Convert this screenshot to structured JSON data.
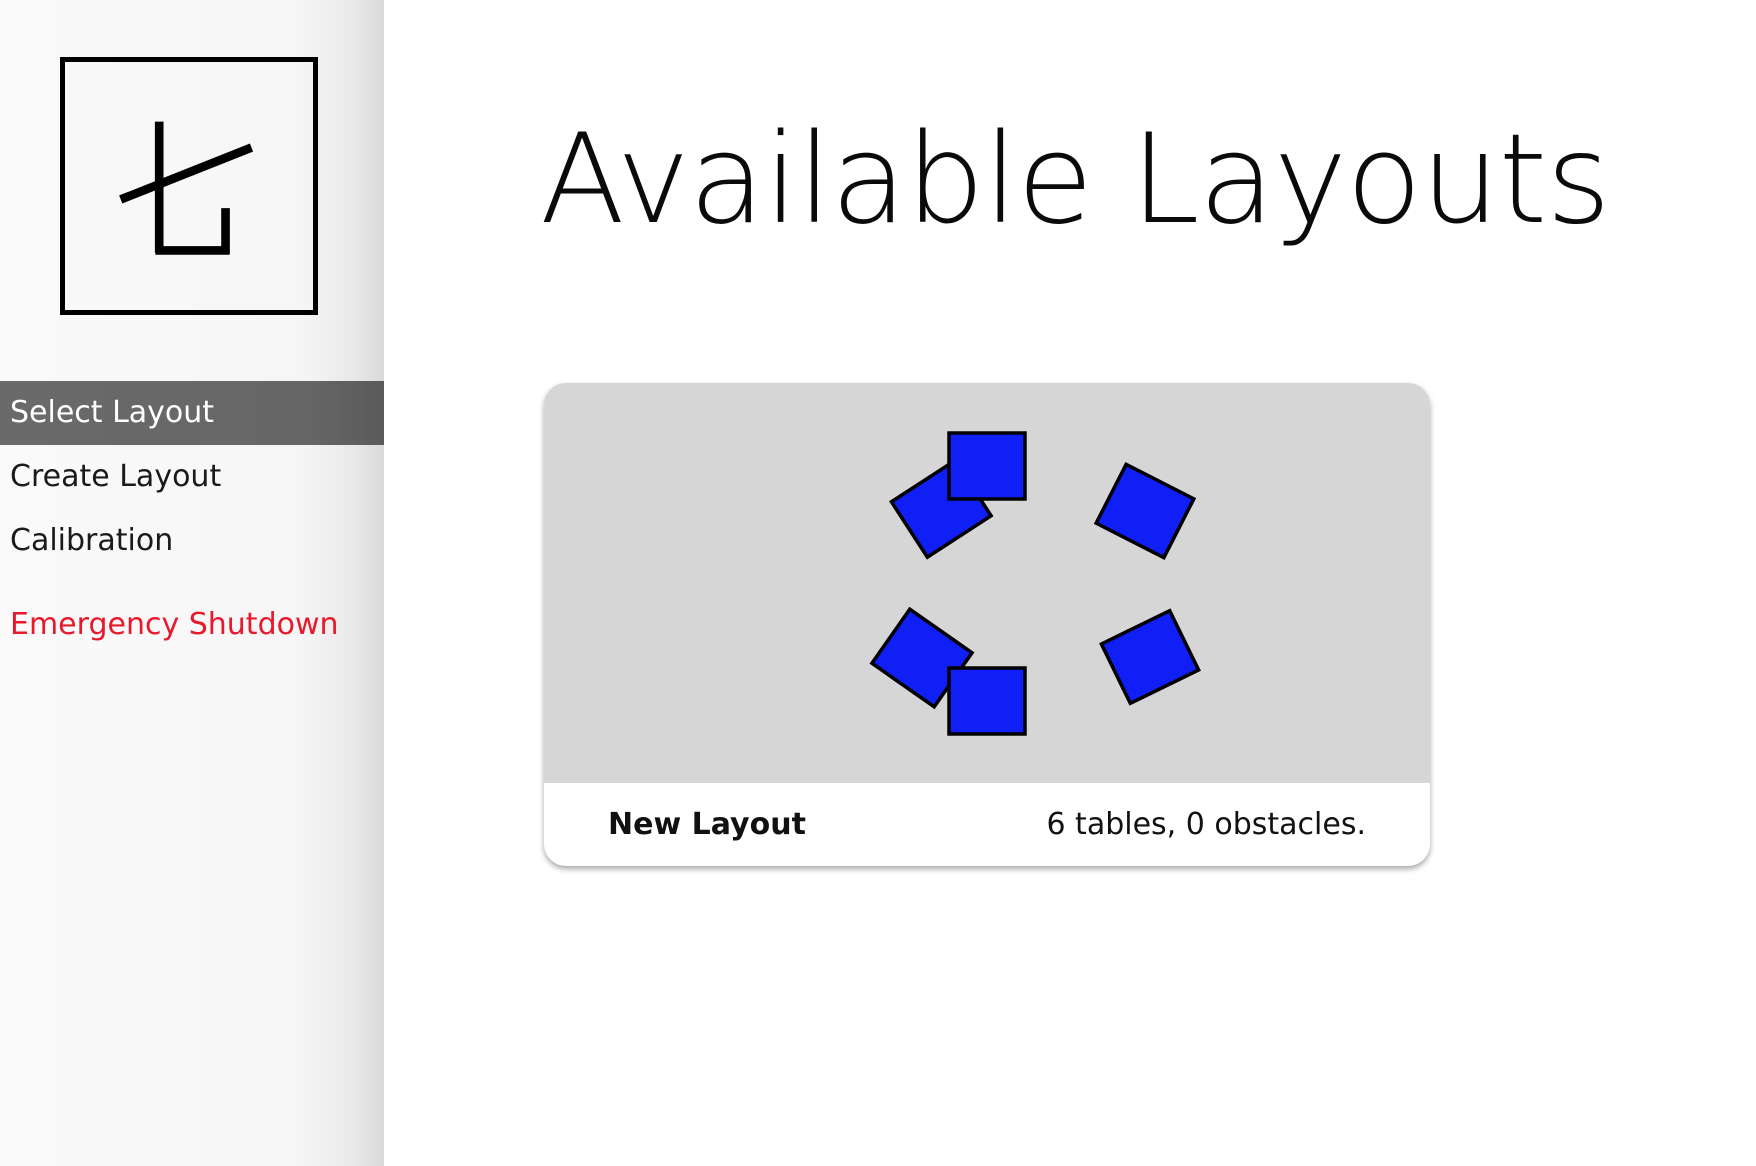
{
  "sidebar": {
    "logo": {
      "icon": "layout-logo-icon"
    },
    "nav_items": [
      {
        "label": "Select Layout",
        "active": true
      },
      {
        "label": "Create Layout",
        "active": false
      },
      {
        "label": "Calibration",
        "active": false
      }
    ],
    "emergency_label": "Emergency Shutdown"
  },
  "main": {
    "title": "Available Layouts",
    "layouts": [
      {
        "name": "New Layout",
        "stats": "6 tables, 0 obstacles.",
        "table_count": 6,
        "obstacle_count": 0
      }
    ]
  },
  "colors": {
    "accent_active_bg": "#666666",
    "danger": "#e8192c",
    "table_fill": "#0f1ff5",
    "preview_bg": "#d6d6d6"
  }
}
